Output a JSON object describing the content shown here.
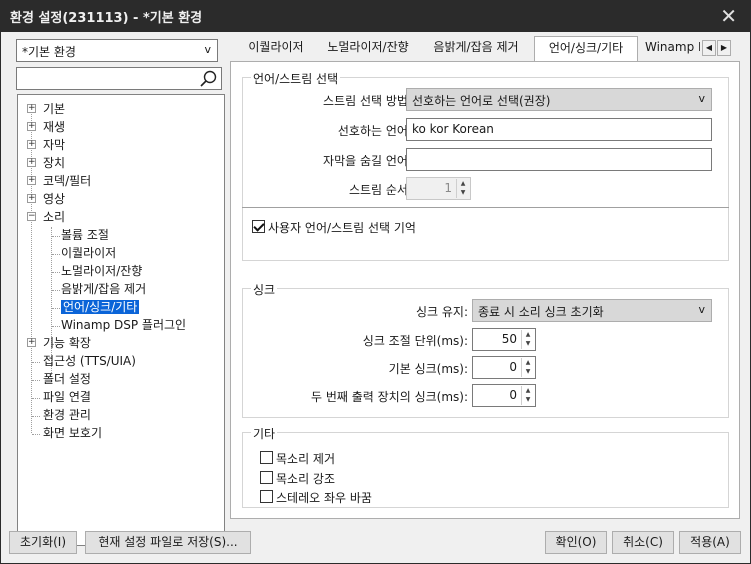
{
  "window": {
    "title": "환경 설정(231113) - *기본 환경",
    "close_glyph": "✕"
  },
  "preset": {
    "value": "*기본 환경",
    "arrow": "v"
  },
  "search": {
    "value": ""
  },
  "tree": {
    "items": [
      {
        "label": "기본",
        "expander": "+"
      },
      {
        "label": "재생",
        "expander": "+"
      },
      {
        "label": "자막",
        "expander": "+"
      },
      {
        "label": "장치",
        "expander": "+"
      },
      {
        "label": "코덱/필터",
        "expander": "+"
      },
      {
        "label": "영상",
        "expander": "+"
      },
      {
        "label": "소리",
        "expander": "−"
      },
      {
        "label": "볼륨 조절"
      },
      {
        "label": "이퀄라이저"
      },
      {
        "label": "노멀라이저/잔향"
      },
      {
        "label": "음밝게/잡음 제거"
      },
      {
        "label": "언어/싱크/기타"
      },
      {
        "label": "Winamp DSP 플러그인"
      },
      {
        "label": "기능 확장",
        "expander": "+"
      },
      {
        "label": "접근성 (TTS/UIA)"
      },
      {
        "label": "폴더 설정"
      },
      {
        "label": "파일 연결"
      },
      {
        "label": "환경 관리"
      },
      {
        "label": "화면 보호기"
      }
    ]
  },
  "tabs": [
    {
      "label": "이퀄라이저"
    },
    {
      "label": "노멀라이저/잔향"
    },
    {
      "label": "음밝게/잡음 제거"
    },
    {
      "label": "언어/싱크/기타"
    },
    {
      "label": "Winamp D"
    }
  ],
  "tabnav": {
    "prev": "◀",
    "next": "▶"
  },
  "stream_group": {
    "legend": "언어/스트림 선택",
    "method_label": "스트림 선택 방법:",
    "method_value": "선호하는 언어로 선택(권장)",
    "preferred_label": "선호하는 언어:",
    "preferred_value": "ko kor Korean",
    "hide_sub_label": "자막을 숨길 언어:",
    "hide_sub_value": "",
    "order_label": "스트림 순서:",
    "order_value": "1",
    "remember_label": "사용자 언어/스트림 선택 기억",
    "remember_checked": true
  },
  "sync_group": {
    "legend": "싱크",
    "keep_label": "싱크 유지:",
    "keep_value": "종료 시 소리 싱크 초기화",
    "step_label": "싱크 조절 단위(ms):",
    "step_value": "50",
    "default_label": "기본 싱크(ms):",
    "default_value": "0",
    "second_label": "두 번째 출력 장치의 싱크(ms):",
    "second_value": "0"
  },
  "other_group": {
    "legend": "기타",
    "remove_voice": "목소리 제거",
    "boost_voice": "목소리 강조",
    "swap_stereo": "스테레오 좌우 바꿈"
  },
  "buttons": {
    "reset": "초기화(I)",
    "save_file": "현재 설정 파일로 저장(S)...",
    "ok": "확인(O)",
    "cancel": "취소(C)",
    "apply": "적용(A)"
  }
}
